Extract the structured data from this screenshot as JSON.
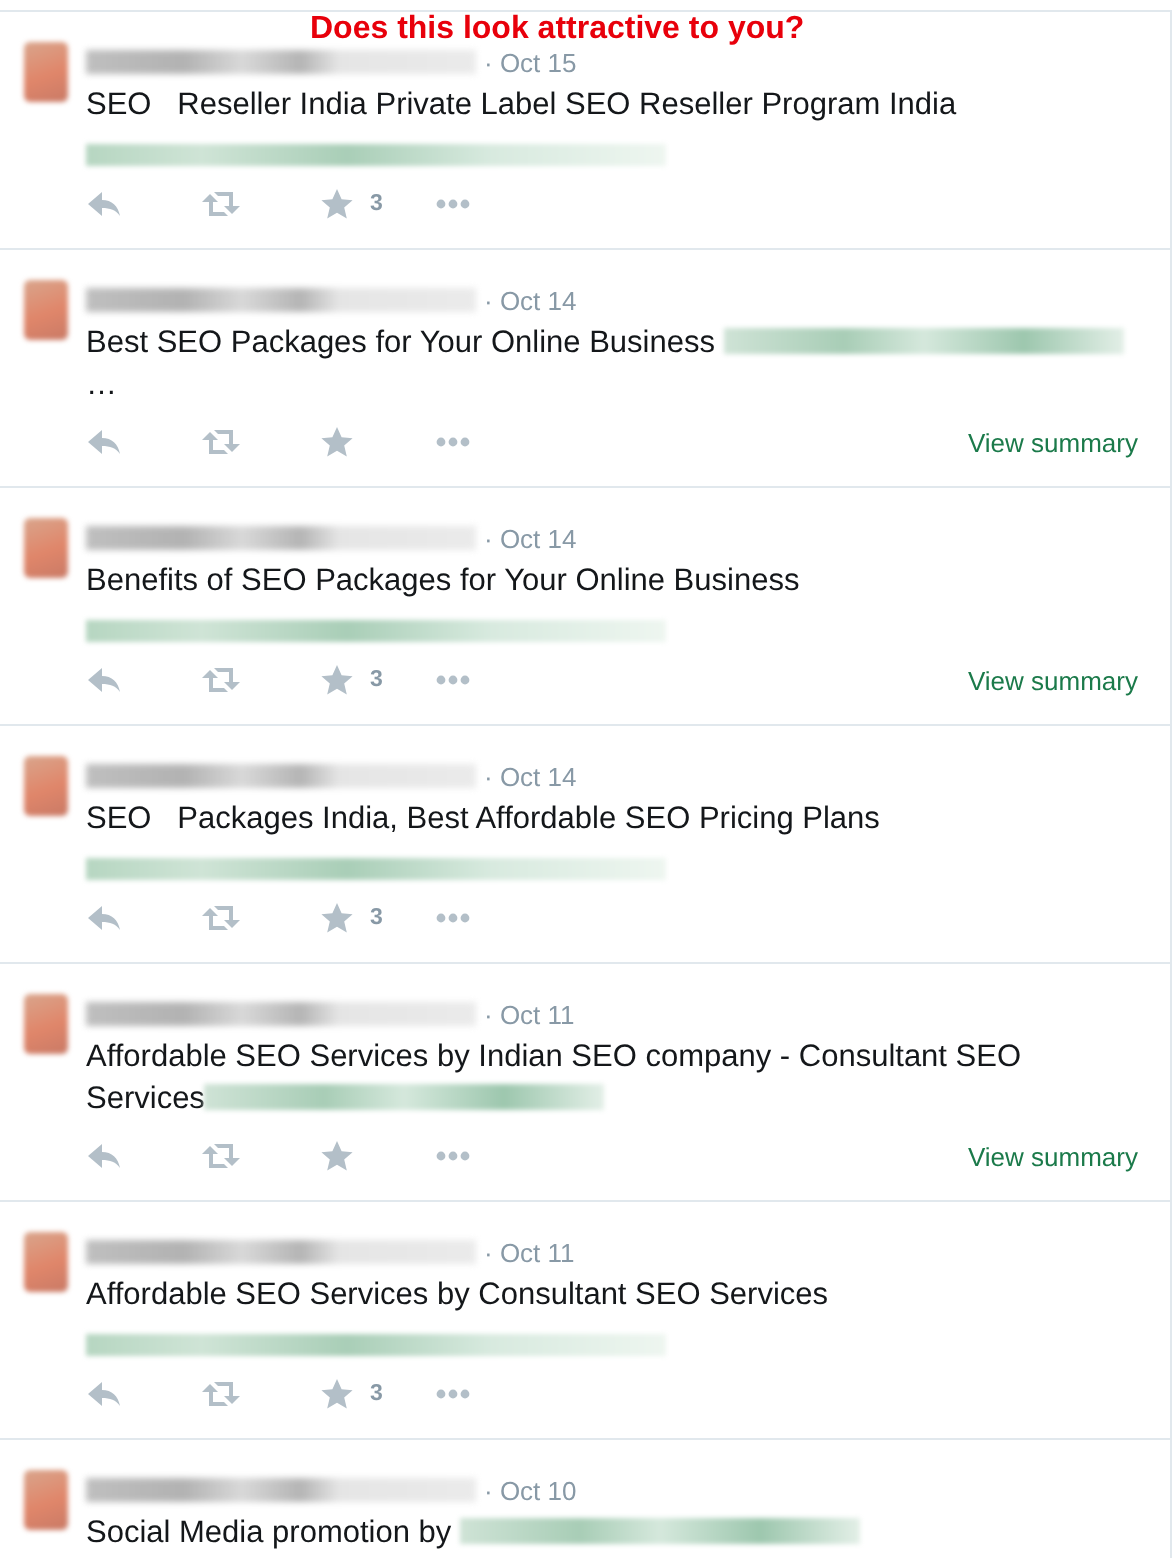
{
  "overlay_caption": "Does this look attractive to you?",
  "tweets": [
    {
      "date": "· Oct 15",
      "text": "SEO   Reseller India Private Label SEO Reseller Program India",
      "kind": "link-below",
      "favorites": "3",
      "actions": true
    },
    {
      "date": "· Oct 14",
      "text": "Best SEO Packages for Your Online Business ",
      "kind": "link-inline",
      "after_link": "…",
      "summary_link": "View summary",
      "actions": true
    },
    {
      "date": "· Oct 14",
      "text": "Benefits of SEO Packages for Your Online Business",
      "kind": "link-below",
      "favorites": "3",
      "summary_link": "View summary",
      "actions": true
    },
    {
      "date": "· Oct 14",
      "text": "SEO   Packages India, Best Affordable SEO Pricing Plans",
      "kind": "link-below",
      "favorites": "3",
      "actions": true
    },
    {
      "date": "· Oct 11",
      "text": "Affordable SEO Services by Indian SEO company - Consultant SEO Services",
      "kind": "link-inline",
      "summary_link": "View summary",
      "actions": true
    },
    {
      "date": "· Oct 11",
      "text": "Affordable SEO Services by Consultant SEO Services",
      "kind": "link-below",
      "favorites": "3",
      "actions": true
    },
    {
      "date": "· Oct 10",
      "text": "Social Media promotion by ",
      "kind": "link-inline",
      "actions": false
    }
  ]
}
